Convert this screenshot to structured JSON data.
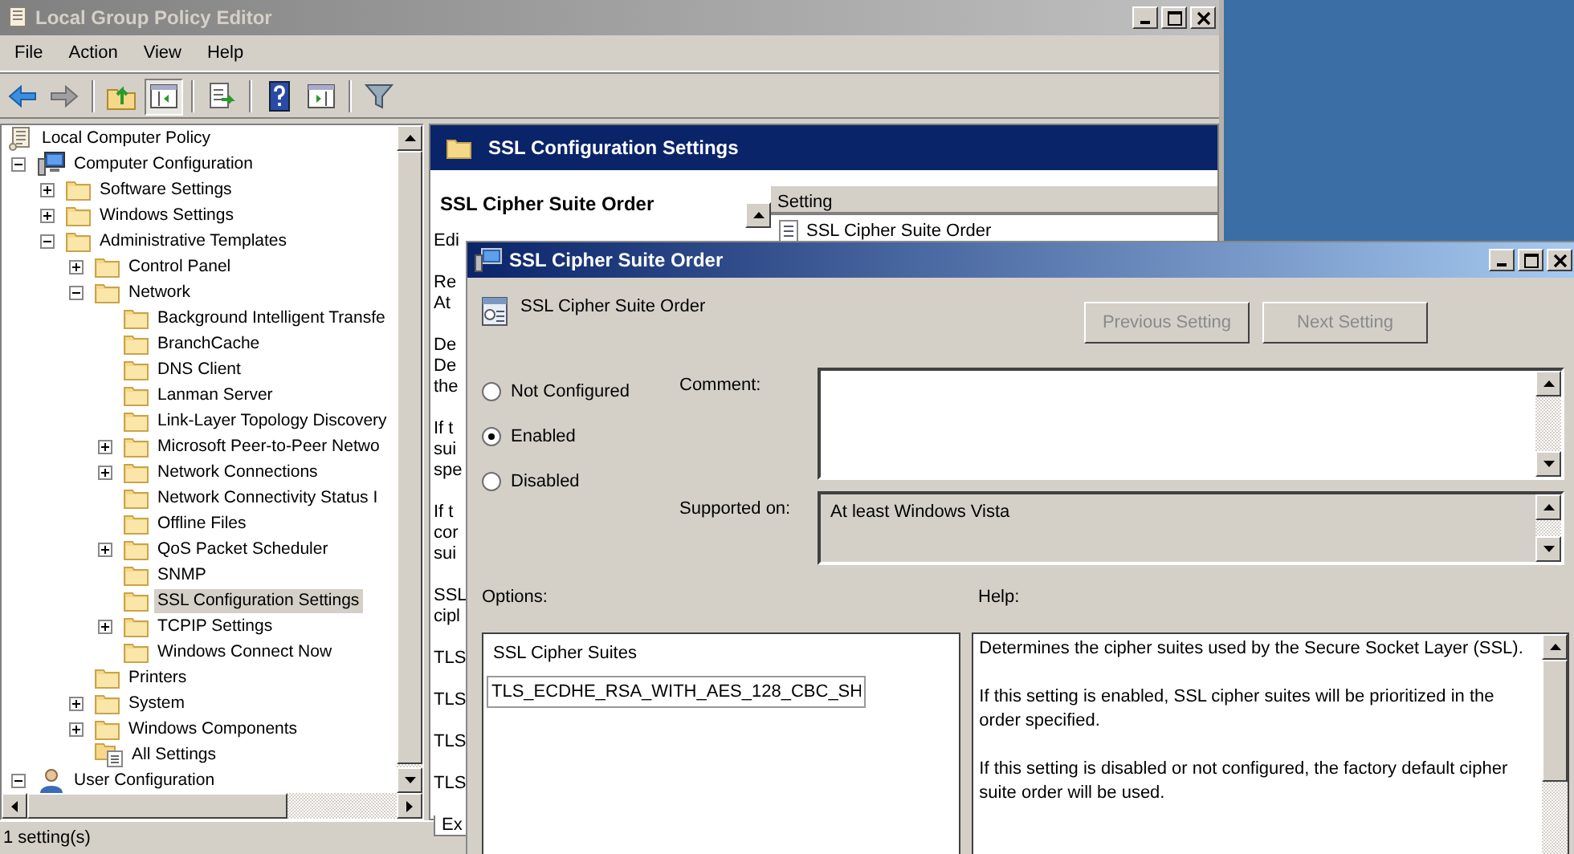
{
  "main_window": {
    "title": "Local Group Policy Editor",
    "active": false
  },
  "menu": [
    "File",
    "Action",
    "View",
    "Help"
  ],
  "toolbar": [
    {
      "kind": "back",
      "pressed": false
    },
    {
      "kind": "forward",
      "pressed": false
    },
    {
      "kind": "separator"
    },
    {
      "kind": "up",
      "pressed": false
    },
    {
      "kind": "tree-toggle",
      "pressed": true
    },
    {
      "kind": "separator"
    },
    {
      "kind": "export",
      "pressed": false
    },
    {
      "kind": "separator"
    },
    {
      "kind": "help",
      "pressed": false
    },
    {
      "kind": "action-pane",
      "pressed": false
    },
    {
      "kind": "separator"
    },
    {
      "kind": "filter",
      "pressed": false
    }
  ],
  "tree": {
    "label": "Local Computer Policy",
    "kind": "policy",
    "selected": false,
    "children": [
      {
        "label": "Computer Configuration",
        "kind": "computer",
        "expanded": true,
        "selected": false,
        "children": [
          {
            "label": "Software Settings",
            "kind": "folder",
            "expanded": false,
            "selected": false
          },
          {
            "label": "Windows Settings",
            "kind": "folder",
            "expanded": false,
            "selected": false
          },
          {
            "label": "Administrative Templates",
            "kind": "folder",
            "expanded": true,
            "selected": false,
            "children": [
              {
                "label": "Control Panel",
                "kind": "folder",
                "expanded": false,
                "selected": false
              },
              {
                "label": "Network",
                "kind": "folder",
                "expanded": true,
                "selected": false,
                "children": [
                  {
                    "label": "Background Intelligent Transfe",
                    "kind": "folder",
                    "selected": false
                  },
                  {
                    "label": "BranchCache",
                    "kind": "folder",
                    "selected": false
                  },
                  {
                    "label": "DNS Client",
                    "kind": "folder",
                    "selected": false
                  },
                  {
                    "label": "Lanman Server",
                    "kind": "folder",
                    "selected": false
                  },
                  {
                    "label": "Link-Layer Topology Discovery",
                    "kind": "folder",
                    "selected": false
                  },
                  {
                    "label": "Microsoft Peer-to-Peer Netwo",
                    "kind": "folder",
                    "expanded": false,
                    "selected": false
                  },
                  {
                    "label": "Network Connections",
                    "kind": "folder",
                    "expanded": false,
                    "selected": false
                  },
                  {
                    "label": "Network Connectivity Status I",
                    "kind": "folder",
                    "selected": false
                  },
                  {
                    "label": "Offline Files",
                    "kind": "folder",
                    "selected": false
                  },
                  {
                    "label": "QoS Packet Scheduler",
                    "kind": "folder",
                    "expanded": false,
                    "selected": false
                  },
                  {
                    "label": "SNMP",
                    "kind": "folder",
                    "selected": false
                  },
                  {
                    "label": "SSL Configuration Settings",
                    "kind": "folder",
                    "selected": true
                  },
                  {
                    "label": "TCPIP Settings",
                    "kind": "folder",
                    "expanded": false,
                    "selected": false
                  },
                  {
                    "label": "Windows Connect Now",
                    "kind": "folder",
                    "selected": false
                  }
                ]
              },
              {
                "label": "Printers",
                "kind": "folder",
                "selected": false
              },
              {
                "label": "System",
                "kind": "folder",
                "expanded": false,
                "selected": false
              },
              {
                "label": "Windows Components",
                "kind": "folder",
                "expanded": false,
                "selected": false
              },
              {
                "label": "All Settings",
                "kind": "all-settings",
                "selected": false
              }
            ]
          }
        ]
      },
      {
        "label": "User Configuration",
        "kind": "user",
        "expanded": true,
        "selected": false
      }
    ]
  },
  "right_pane": {
    "header": "SSL Configuration Settings",
    "detail_title": "SSL Cipher Suite Order",
    "detail_paragraphs": [
      {
        "lines": [
          "Edi"
        ]
      },
      {
        "lines": [
          "Re",
          "At"
        ]
      },
      {
        "lines": [
          "De",
          "De",
          "the"
        ]
      },
      {
        "lines": [
          "If t",
          "sui",
          "spe"
        ]
      },
      {
        "lines": [
          "If t",
          "cor",
          "sui"
        ]
      },
      {
        "lines": [
          "SSL",
          "cipl"
        ]
      },
      {
        "lines": [
          "TLS"
        ]
      },
      {
        "lines": [
          "TLS"
        ]
      },
      {
        "lines": [
          "TLS"
        ]
      },
      {
        "lines": [
          "TLS"
        ]
      }
    ],
    "tabs": [
      {
        "label": "Ex",
        "selected": true
      }
    ],
    "list": {
      "columns": [
        "Setting"
      ],
      "rows": [
        {
          "name": "SSL Cipher Suite Order"
        }
      ]
    }
  },
  "status_bar": "1 setting(s)",
  "dialog": {
    "title": "SSL Cipher Suite Order",
    "active": true,
    "setting_name": "SSL Cipher Suite Order",
    "buttons": [
      {
        "label": "Previous Setting",
        "disabled": true
      },
      {
        "label": "Next Setting",
        "disabled": true
      }
    ],
    "states": [
      {
        "label": "Not Configured",
        "selected": false
      },
      {
        "label": "Enabled",
        "selected": true
      },
      {
        "label": "Disabled",
        "selected": false
      }
    ],
    "comment_label": "Comment:",
    "supported_label": "Supported on:",
    "supported_value": "At least Windows Vista",
    "options_label": "Options:",
    "help_label": "Help:",
    "options": {
      "field_label": "SSL Cipher Suites",
      "value": "TLS_ECDHE_RSA_WITH_AES_128_CBC_SH"
    },
    "help": [
      "Determines the cipher suites used by the Secure Socket Layer (SSL).",
      "If this setting is enabled, SSL cipher suites will be prioritized in the order specified.",
      "If this setting is disabled or not configured, the factory default cipher suite order will be used."
    ]
  }
}
